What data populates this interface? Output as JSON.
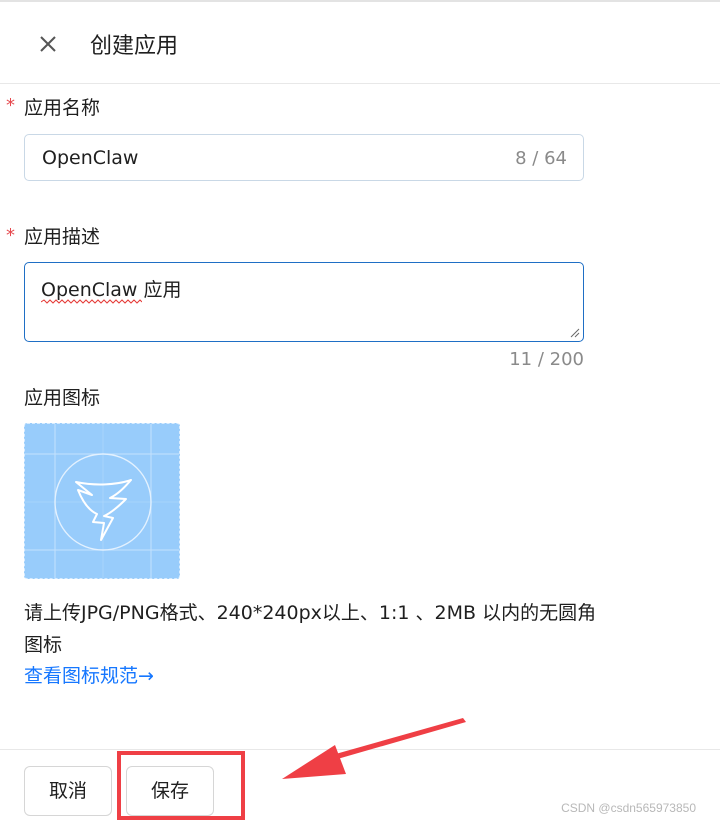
{
  "header": {
    "title": "创建应用",
    "close_icon": "close-icon"
  },
  "form": {
    "name": {
      "required_mark": "*",
      "label": "应用名称",
      "value": "OpenClaw",
      "counter": "8 / 64"
    },
    "description": {
      "required_mark": "*",
      "label": "应用描述",
      "value": "OpenClaw 应用",
      "counter": "11 / 200"
    },
    "icon": {
      "label": "应用图标",
      "placeholder_icon": "dingtalk-wing-icon",
      "hint": "请上传JPG/PNG格式、240*240px以上、1:1 、2MB 以内的无圆角图标",
      "link": "查看图标规范→"
    }
  },
  "footer": {
    "cancel_label": "取消",
    "save_label": "保存"
  },
  "annotation": {
    "color": "#ef3f45",
    "target": "save-button"
  },
  "watermark": "CSDN @csdn565973850",
  "colors": {
    "accent": "#1677ff",
    "required": "#e5484d",
    "upload_bg": "#98ccfb"
  }
}
